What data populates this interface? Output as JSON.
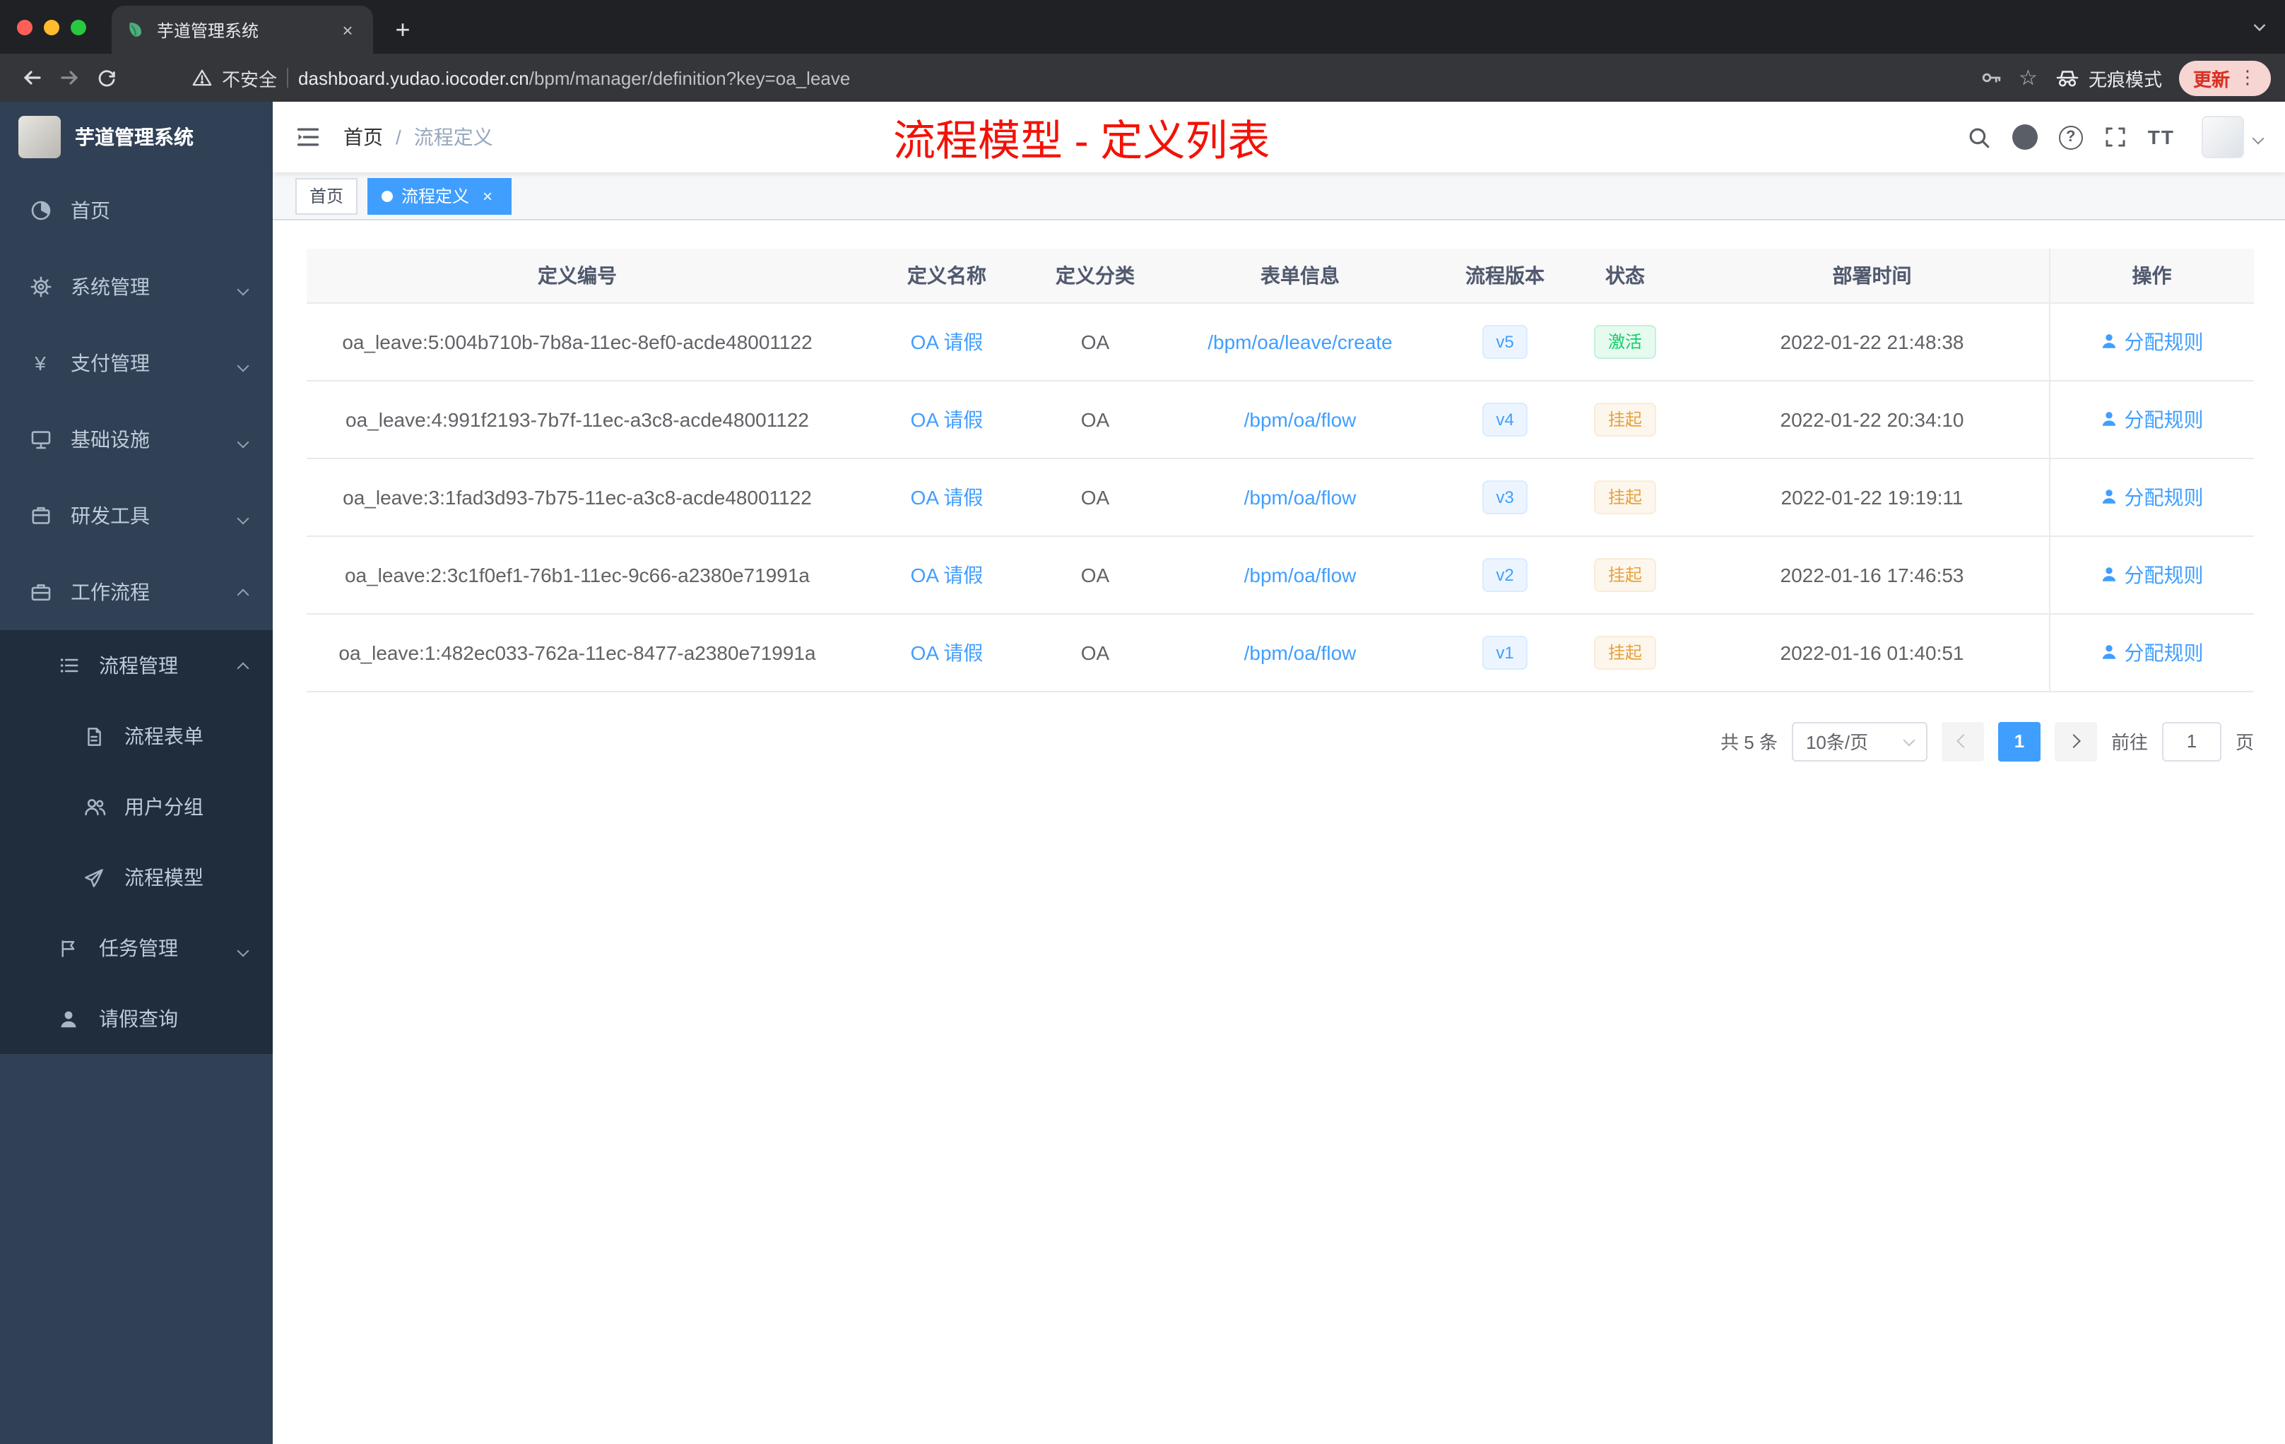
{
  "colors": {
    "accent": "#409eff",
    "success": "#13ce66",
    "warning": "#e6a23c",
    "annotation_red": "#f41106",
    "sidebar_bg": "#304156",
    "submenu_bg": "#1f2d3d"
  },
  "browser": {
    "tab_title": "芋道管理系统",
    "security_label": "不安全",
    "url_domain": "dashboard.yudao.iocoder.cn",
    "url_path": "/bpm/manager/definition?key=oa_leave",
    "incognito_label": "无痕模式",
    "update_label": "更新"
  },
  "icons": {
    "close": "×",
    "new_tab": "+",
    "star": "☆",
    "more_vert": "⋮",
    "yen": "¥",
    "question": "?",
    "font_size": "TT"
  },
  "sidebar": {
    "logo_title": "芋道管理系统",
    "items": [
      {
        "label": "首页"
      },
      {
        "label": "系统管理"
      },
      {
        "label": "支付管理"
      },
      {
        "label": "基础设施"
      },
      {
        "label": "研发工具"
      },
      {
        "label": "工作流程"
      }
    ],
    "submenu": [
      {
        "label": "流程管理"
      },
      {
        "label": "流程表单"
      },
      {
        "label": "用户分组"
      },
      {
        "label": "流程模型"
      },
      {
        "label": "任务管理"
      },
      {
        "label": "请假查询"
      }
    ]
  },
  "header": {
    "breadcrumb_home": "首页",
    "breadcrumb_sep": "/",
    "breadcrumb_current": "流程定义",
    "annotation_title": "流程模型 - 定义列表"
  },
  "tags": {
    "home": "首页",
    "active": "流程定义"
  },
  "table": {
    "columns": [
      "定义编号",
      "定义名称",
      "定义分类",
      "表单信息",
      "流程版本",
      "状态",
      "部署时间",
      "操作"
    ],
    "rows": [
      {
        "id": "oa_leave:5:004b710b-7b8a-11ec-8ef0-acde48001122",
        "name": "OA 请假",
        "category": "OA",
        "form": "/bpm/oa/leave/create",
        "version": "v5",
        "status": "激活",
        "deploy_time": "2022-01-22 21:48:38",
        "action": "分配规则"
      },
      {
        "id": "oa_leave:4:991f2193-7b7f-11ec-a3c8-acde48001122",
        "name": "OA 请假",
        "category": "OA",
        "form": "/bpm/oa/flow",
        "version": "v4",
        "status": "挂起",
        "deploy_time": "2022-01-22 20:34:10",
        "action": "分配规则"
      },
      {
        "id": "oa_leave:3:1fad3d93-7b75-11ec-a3c8-acde48001122",
        "name": "OA 请假",
        "category": "OA",
        "form": "/bpm/oa/flow",
        "version": "v3",
        "status": "挂起",
        "deploy_time": "2022-01-22 19:19:11",
        "action": "分配规则"
      },
      {
        "id": "oa_leave:2:3c1f0ef1-76b1-11ec-9c66-a2380e71991a",
        "name": "OA 请假",
        "category": "OA",
        "form": "/bpm/oa/flow",
        "version": "v2",
        "status": "挂起",
        "deploy_time": "2022-01-16 17:46:53",
        "action": "分配规则"
      },
      {
        "id": "oa_leave:1:482ec033-762a-11ec-8477-a2380e71991a",
        "name": "OA 请假",
        "category": "OA",
        "form": "/bpm/oa/flow",
        "version": "v1",
        "status": "挂起",
        "deploy_time": "2022-01-16 01:40:51",
        "action": "分配规则"
      }
    ]
  },
  "pagination": {
    "total": "共 5 条",
    "page_size": "10条/页",
    "current_page": "1",
    "goto_label": "前往",
    "goto_value": "1",
    "unit_label": "页"
  }
}
